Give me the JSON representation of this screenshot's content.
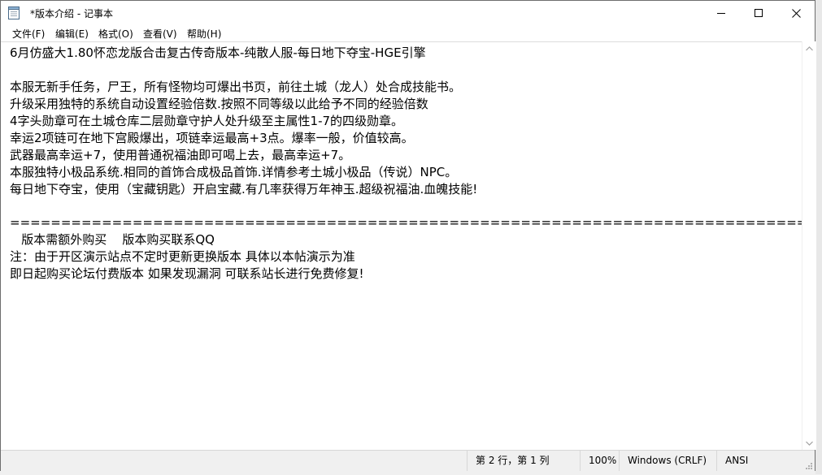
{
  "window": {
    "title": "*版本介绍 - 记事本"
  },
  "icons": {
    "app": "notepad-icon",
    "minimize": "minimize-icon",
    "maximize": "maximize-icon",
    "close": "close-icon",
    "scroll_up": "scroll-up-arrow-icon",
    "scroll_down": "scroll-down-arrow-icon",
    "grip": "resize-grip-icon"
  },
  "menu": {
    "file": "文件(F)",
    "edit": "编辑(E)",
    "format": "格式(O)",
    "view": "查看(V)",
    "help": "帮助(H)"
  },
  "document": {
    "lines": [
      "6月仿盛大1.80怀恋龙版合击复古传奇版本-纯散人服-每日地下夺宝-HGE引擎",
      "",
      "本服无新手任务，尸王，所有怪物均可爆出书页，前往土城（龙人）处合成技能书。",
      "升级采用独特的系统自动设置经验倍数.按照不同等级以此给予不同的经验倍数",
      "4字头勋章可在土城仓库二层勋章守护人处升级至主属性1-7的四级勋章。",
      "幸运2项链可在地下宫殿爆出，项链幸运最高+3点。爆率一般，价值较高。",
      "武器最高幸运+7，使用普通祝福油即可喝上去，最高幸运+7。",
      "本服独特小极品系统.相同的首饰合成极品首饰.详情参考土城小极品（传说）NPC。",
      "每日地下夺宝，使用（宝藏钥匙）开启宝藏.有几率获得万年神玉.超级祝福油.血魄技能!",
      "",
      "=========================================================================================",
      "   版本需额外购买    版本购买联系QQ",
      "注：由于开区演示站点不定时更新更换版本 具体以本帖演示为准",
      "即日起购买论坛付费版本 如果发现漏洞 可联系站长进行免费修复!"
    ]
  },
  "status": {
    "position": "第 2 行，第 1 列",
    "zoom": "100%",
    "line_ending": "Windows (CRLF)",
    "encoding": "ANSI"
  }
}
